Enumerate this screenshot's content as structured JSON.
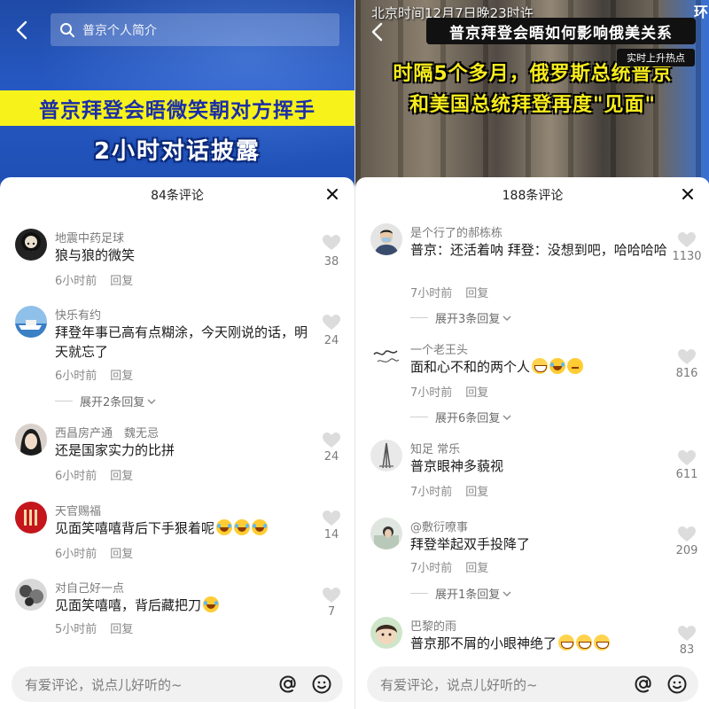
{
  "left": {
    "search_placeholder": "普京个人简介",
    "banner_yellow": "普京拜登会晤微笑朝对方挥手",
    "banner_white": "2小时对话披露",
    "comment_count_title": "84条评论",
    "comments": [
      {
        "user": "地震中药足球",
        "text": "狼与狼的微笑",
        "time": "6小时前",
        "reply": "回复",
        "likes": "38"
      },
      {
        "user": "快乐有约",
        "text": "拜登年事已高有点糊涂，今天刚说的话，明天就忘了",
        "time": "6小时前",
        "reply": "回复",
        "likes": "24",
        "expand": "展开2条回复"
      },
      {
        "user": "西昌房产通　魏无忌",
        "text": "还是国家实力的比拼",
        "time": "6小时前",
        "reply": "回复",
        "likes": "24"
      },
      {
        "user": "天官赐福",
        "text": "见面笑嘻嘻背后下手狠着呢",
        "time": "6小时前",
        "reply": "回复",
        "likes": "14"
      },
      {
        "user": "对自己好一点",
        "text": "见面笑嘻嘻，背后藏把刀",
        "time": "5小时前",
        "reply": "回复",
        "likes": "7"
      }
    ],
    "input_placeholder": "有爱评论，说点儿好听的~"
  },
  "right": {
    "time_caption": "北京时间12月7日晚23时许",
    "corner_text": "环",
    "topic_title": "普京拜登会晤如何影响俄美关系",
    "hot_badge": "实时上升热点",
    "caption_line1": "时隔5个多月，俄罗斯总统普京",
    "caption_line2": "和美国总统拜登再度\"见面\"",
    "comment_count_title": "188条评论",
    "comments": [
      {
        "user": "是个行了的郝栋栋",
        "text": "普京：还活着呐 拜登：没想到吧，哈哈哈哈",
        "time": "7小时前",
        "reply": "回复",
        "likes": "1130",
        "expand": "展开3条回复"
      },
      {
        "user": "一个老王头",
        "text": "面和心不和的两个人",
        "time": "7小时前",
        "reply": "回复",
        "likes": "816",
        "expand": "展开6条回复"
      },
      {
        "user": "知足 常乐",
        "text": "普京眼神多藐视",
        "time": "7小时前",
        "reply": "回复",
        "likes": "611"
      },
      {
        "user": "@敷衍嘹事",
        "text": "拜登举起双手投降了",
        "time": "7小时前",
        "reply": "回复",
        "likes": "209",
        "expand": "展开1条回复"
      },
      {
        "user": "巴黎的雨",
        "text": "普京那不屑的小眼神绝了",
        "likes": "83"
      }
    ],
    "input_placeholder": "有爱评论，说点儿好听的~"
  },
  "icons": {
    "back": "back-arrow-icon",
    "search": "search-icon",
    "close": "close-icon",
    "like": "heart-icon",
    "at": "at-sign-icon",
    "emoji": "smiley-icon"
  },
  "colors": {
    "banner_yellow_bg": "#f7f21a",
    "banner_text_blue": "#1b2ea8",
    "caption_yellow": "#f7ec1e",
    "muted_text": "#7b7b7b"
  }
}
